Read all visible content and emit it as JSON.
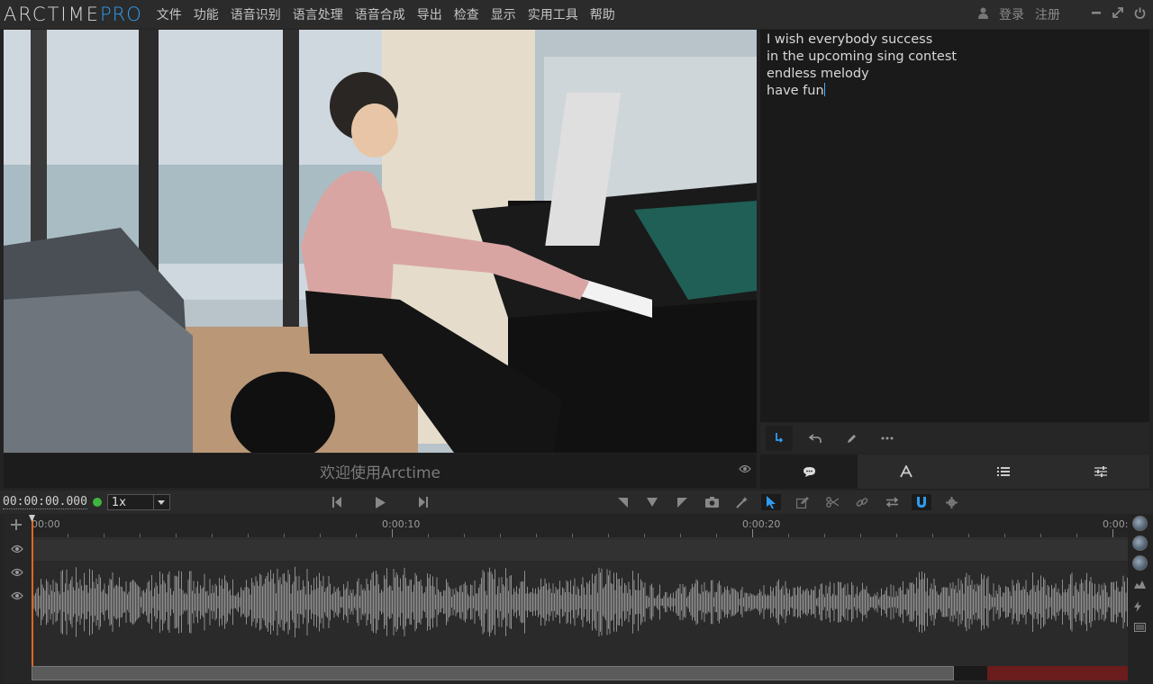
{
  "app": {
    "logo_main": "ARCTIME",
    "logo_accent": "PRO",
    "menu": [
      "文件",
      "功能",
      "语音识别",
      "语言处理",
      "语音合成",
      "导出",
      "检查",
      "显示",
      "实用工具",
      "帮助"
    ],
    "login": "登录",
    "register": "注册"
  },
  "player": {
    "subtitle_placeholder": "欢迎使用Arctime"
  },
  "editor": {
    "lines": [
      "I wish everybody success",
      "in the upcoming sing contest",
      "endless melody",
      "have fun"
    ]
  },
  "transport": {
    "timecode": "00:00:00.000",
    "speed": "1x"
  },
  "timeline": {
    "ruler_labels": [
      "00:00",
      "0:00:10",
      "0:00:20",
      "0:00:"
    ]
  },
  "colors": {
    "accent": "#2f9cf0",
    "playhead": "#e06820",
    "status_green": "#3fb43f"
  }
}
